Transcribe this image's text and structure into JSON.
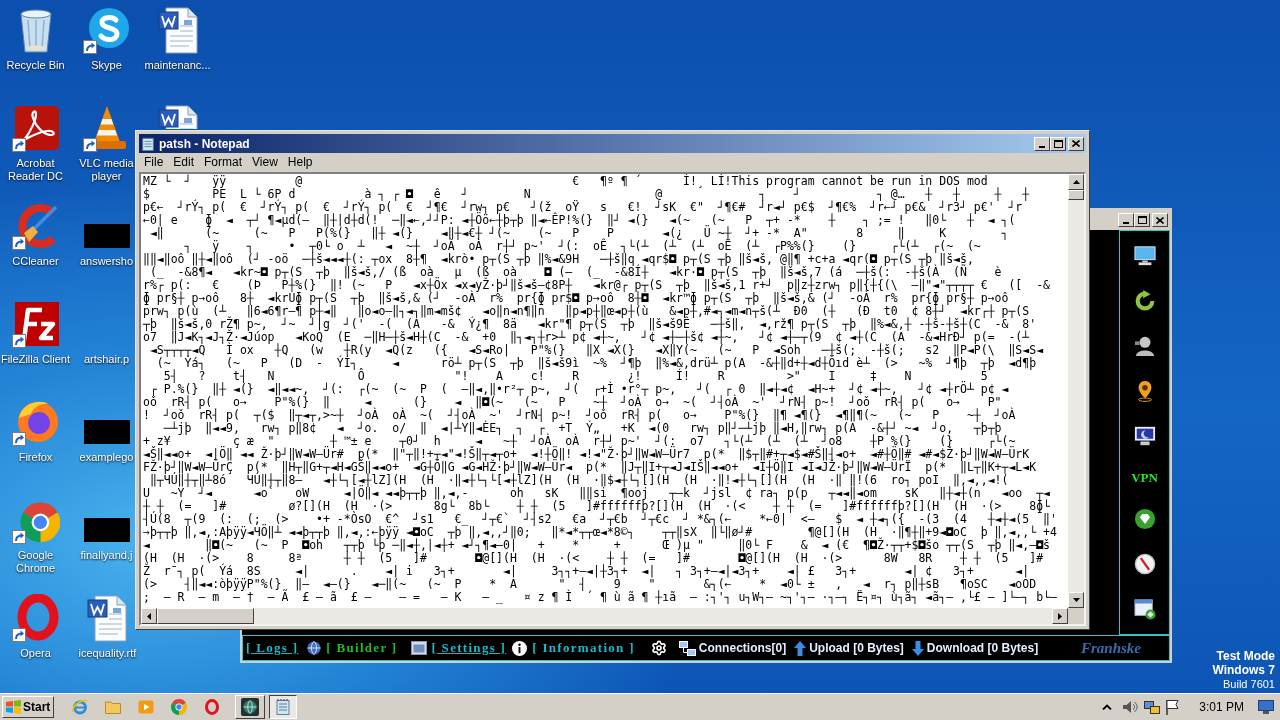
{
  "desktop": {
    "icons": [
      {
        "kind": "recycle",
        "label": "Recycle Bin",
        "shortcut": false
      },
      {
        "kind": "acrobat",
        "label": "Acrobat Reader DC",
        "shortcut": true
      },
      {
        "kind": "ccleaner",
        "label": "CCleaner",
        "shortcut": true
      },
      {
        "kind": "filezilla",
        "label": "FileZilla Client",
        "shortcut": true
      },
      {
        "kind": "firefox",
        "label": "Firefox",
        "shortcut": true
      },
      {
        "kind": "chrome",
        "label": "Google Chrome",
        "shortcut": true
      },
      {
        "kind": "opera",
        "label": "Opera",
        "shortcut": true
      },
      {
        "kind": "skype",
        "label": "Skype",
        "shortcut": true
      },
      {
        "kind": "vlc",
        "label": "VLC media player",
        "shortcut": true
      },
      {
        "kind": "thumbnail",
        "label": "answersho"
      },
      {
        "kind": "blank",
        "label": "artshair.p"
      },
      {
        "kind": "thumbnail",
        "label": "examplego"
      },
      {
        "kind": "thumbnail",
        "label": "finallyand.j"
      },
      {
        "kind": "word",
        "label": "icequality.rtf",
        "shortcut": false
      },
      {
        "kind": "word",
        "label": "maintenanc...",
        "shortcut": false
      },
      {
        "kind": "word"
      }
    ],
    "notice": [
      "Test Mode",
      "Windows 7",
      "Build 7601"
    ]
  },
  "notepad": {
    "title": "patsh - Notepad",
    "menu": [
      "File",
      "Edit",
      "Format",
      "View",
      "Help"
    ],
    "lines": [
      "MZ └  ┘   ÿÿ          @                                       €   ¶º ¶ ´      Í!¸ LÍ!This program cannot be run in DOS mod",
      "$         PE  L └ 6P d          à ┐ ┌ ◘   ê   ┘        N                  @              ┐    ┘           ┐ @…   ┼   ┼     ┼   ┼",
      "p€←  ┘rÝ┐ p(  €  ┘rÝ┐ p(  €  ┘rÝ┐ p(  €  ┘¶€  ┘rw┐ p€   ┘(ž  oŸ   s   €!  ┘sK  €\"  ┘¶€#  ┘r◄┘ p€$  ┘¶€%  ┘r←┘ p€&  ┘r3┘ p€'  ┘r",
      "←0| e    ɸ  ◄  ┬┘ ¶◄µd(–  ‖┼|d┼d(!  ─‖◄←,┘┘P: ◄┼Öö←┼þ┬þ ‖◄←ÊP!%(}  ‖┘ ◄(}   ◄(~   (~   P  ┬+ -*    ┼    ┐ ;= !   ‖0└   ┼  ◄ ┐(",
      " ◄‖      (~     (~   P   P(%(}   ‖┼ ◄(}    ◄‖┼◄€┼ ┘(~    (~   P    P       ◄(¿   Ü ~┼  ┘+ -*  A\"       8     ‖     K        ┐",
      "      ┐   ÿ    ┐     •  ┬0└ o  ┴   ◄  ~┼  ┘oÀ  oÀ  r┼┘ p~'  ┘(:  oÊ  ┐└(┴  (┴  (┴  oË  (┴  ┌P%%(}    (}     ┌└(┴  ┌(~  (~",
      "‖‖◄‖oô ‖┼◄‖oô  (┘ -oö  ─┼š◄◄◄┼(: ┬ox  8┼¶  ◄krò• p┬(S ┬þ ‖%◄&9H   ─┼š‖q ◄qr$◘ p┬(S ┬þ ‖š◄š, @‖¶ +c+a ◄qr(◘ p┬(S ┬þ ‖š◄š,",
      " (_  -&8¶◄   ◄kr~◘ p┬(S  ┬þ  ‖š◄š,/ (ß  oà   µ  (ß  oà    ◘ (–  (_  -&8Í┼   ◄kr·◘ p┬(S  ┬þ  ‖š◄š,7 (á  ─┼š(:  -┼š(À  (Ñ    è",
      "r%┌ p(:   €    (Þ   P┼%(}  ‖! (~   P   ◄x┼Öx ◄x◄yŽ·þ┘‖š◄š–¢8P┼   ◄kr@┌ p┬(S  ┬þ  ‖š◄š,1 r+┘  p‖z┼zrw┐ p‖{┼{(\\  –‖\"◄\"┬┬┬┬ €   ([  -&",
      "ɸ pr§┼ p→oô   8┼  ◄krUɸ p┬(S  ┬þ  ‖š◄š,& (┘  -oÀ  r%  pr{ɸ pr$◘ p→oô  8┼◘  ◄kr™ɸ p┬(S  ┬þ  ‖š◄š,& (┘  -oÀ  r%  pr{ɸ pr§┼ p→oô",
      "prw┐ p(ù  (┴   ‖6◄6¶r–¶ p┼◄‖   ‖o◄o–‖┐◄┐‖m◄mš¢   ◄o‖n◄n¶‖n   ‖p◄p┼‖œ◄p┼(ù   &◄p┼,#◄┐◄m◄n┬š(┴  Ð0  (┼   (Ð  t0  ¢ 8┼┘  ◄kr┌┼ p┬(S",
      "┬þ  ‖š◄š,0 rŽ¶ p~,  ┘~  ┘|g  ┘('  -(  (A   -&  Ý¿¶  8ä   ◄kr\"¶ p┬(S  ┬þ  ‖š◄š9Ê   ─┼š‖,  ◄,rž¶ p┬(S  ┬þ  ‖%◄&,┼ -┼š-┼š┼(C  -&  8'",
      "o7  ‖J◄K┐◄J┐Ž·◄Júop   ◄KoQ  (E  ─‖H─┼š◄H┼(C  -&  +0  ‖┐◄┐┼r>┴ p¢ ◄┼~,   ┘¢ ◄┼─┼š¢ ◄┼~,   ┘¢ ◄┼─┬(9  ¢ ◄┼(C  (A  -&◄HrÐ┘ p(=  -(┴",
      " ◄S┬┬┬┬◄Q   Ì ox   ┼Q   (w   ┼R(y  ◄Q(z   ({   ◄S◄Ro|   P\"%(}   ‖X ◄X(}   ◄X‖Y(~   (~   P  ◄Soh   ─┼š(;  -┼š(;   s2  ‖P◄P(\\  ‖S◄S◄",
      "  (~  Ýá┐   (~   P   (D  -  ÝÍ┐     ◄      rö┴ p┬(S  ┬þ  ‖š◄š9ì  ~%  ┘¶þ  ‖%◄&,drü┴ p(A  -&┼‖d+┼◄d┼Öıd è┴  (>   ~%  ┘¶þ  ┬þ  ◄d¶þ",
      "   5┤   ?    t┤   N            Ô             \"!    A    c!    R       ¿!     Í!    R         >\"    I     ‡    N          5",
      " ┌ P.%(}  ‖┼ ◄(}  ◄‖◄◄~,  ┘(:  ┌(~  (~  P  (  –‖◄,‖•r²┬ p~,  ┘(  ┌+Ì •r°┬ p~,   ┘(  ┌ 0  ‖◄┼◄¢  ◄H~+  ┘¢ ◄┼~,   ┘¢ ◄┼rÖ┴ p¢ ◄",
      "oǒ  rR┤ p(   o→    P\"%(}  ‖     ◄      (}    ◄  ‖◘(~   (~   P    ~┼  ┘oÀ  o→  ~(  ┘┤oÀ  ~'  ┘rN┤ p~!  ┘oǒ  rR┤ p(   o→    P\"",
      "!  ┘oǒ  rR┤ p(  ┬($  ‖┬◄┬,>~┼  ┘oÀ  oÀ  ~(  ┘┤oÀ  ~'  ┘rN┤ p~!  ┘oǒ  rR┤ p(   o→    P\"%(}  ‖¶ ◄¶(}  ◄¶‖¶(~   (~   P    ~┼  ┘oÀ",
      "   ─┴jþ  ‖◄◄9,   rw┐ p‖8¢   ◄  ┘o.  o/  ‖  ◄|┴Y‖◄ÈE┐  ┐  ┌  +T  Ý„   +K  ◄(0   rw┐ p‖┘─┴jþ ‖◄H,‖rw┐ p(A  -&┼┘ ~◄  ┘o,   ┬þ┬þ",
      "+ z¥         ç æ  \"        ┼ ™± e    ┬0┘  h     ◄   ~┼  ┘oÀ  oÀ  r┼┘ p~'  ┘(:  o7   ┐└(┴  (┴  (┴  ┘o8    ┼P %(}    (}     ┌└(~",
      "◄Š‖◄◄o+  ◄|Ö‖ ◄◄ Ž·þ┘‖W◄W–Ür#  p(*  ‖\"┬‖!+┬◄\"◄!Š‖┬◄┬o+  ◄!┼Ö‖! ◄!◄\"Ž·þ┘‖W◄W–Ür7  p(*  ‖$┬‖#+┬◄$◄#Š‖┤◄o+  ◄#┼Ö‖# ◄#◄$Ž·þ┘‖W◄W–ÜrK",
      "FŽ·þ┘‖W◄W–ÜrÇ  p(*  ‖H┬‖G+┬◄H◄GŠ‖◄◄o+  ◄G┼Ö‖G ◄G◄HŽ·þ┘‖W◄W–Ür◄  p(*  ‖J┬‖I+┬◄J◄IŠ‖◄◄o+  ◄I┼Ö‖I ◄I◄JŽ·þ┘‖W◄W–ÜrÏ  p(*  ‖L┬‖K+┬◄L◄K",
      " ‖┬ЧÚ‖┼┬‖┴8ó   ЧÚ‖┼┬‖8–   ◄┼└┐[◄┼lZ](H  (H  ·‖◄┼└┐└[◄┼lZ](H  (H  ·‖$◄┼└┐[](H  (H  ·‖!◄┼└┐[](H  (H  ·‖ ‖!(6  ro┐ poI  ‖,◄,,◄!(",
      "U   ~Y  ┘◄      ◄o`   oW     ◄|Ö‖◄ ◄◄þ┬┬þ ‖,◄,-      oh   sK   ‖‖si  ¶ooj   ┬–k  ┘jsl  ¢ ra┐ p(p   ┬◄◄‖◄om    sK   ‖┼◄┼(n   ◄oo  ┬◄",
      "┼ ┼  (=   ]#         ø?[](H  (H  ·(>      8g└  8b└    ┼ ┼  (5   ]#ffffffþ?[](H  (H  ·(<    ┼ ┼  (=   ]#ffffffþ?[](H  (H  ·(>    8ɸ└",
      "┤Ú(8  ┬(9  (:  (;  (>    •+ -*ÒsO  €^  ┘s1   €_  ┘┬€`  ┘┤s2   €a  ┘┬€b  ┘┬€c  ┘ *&┐(←    *←0|  <–   $  ◄ ┼◄┐({  -(3  (4   ┼◄┼◄(5  ‖'",
      "→þ┬┬þ ‖,◄,:Aþÿÿ◄ЧÖ‖┴ ◄◄þ┬┬þ ‖,◄,:←þÿÿ ◄◘oC  ┬þ ‖,◄,,┘‖0;   ‖*◄*┬┬œ◄*8©┐    ┬┬‖sX  ‖└‖ø┘#        ¶@[](H  (H  ·‖¶┼‖+9◄◘oC  þ ‖,◄,,└ +4",
      "◄        ‖◘(~   (~  P  ◘oh   ┬┬þ └þ ─‖◄┼,|◄┼+ ◄┘┐¶◄–0|   +    *     +      Œ )µ \"     ‖0└ F    &  ◄ (€  ¶◘Ž·┬┬+$◘šo ┬┬(S  ┬þ ‖◄,–◘š",
      "(H  (H  ·(>    8     8ª      ┼ ┼  (5   ]#       ◘@[](H  (H  ·(<    ┼ ┼  (=   ]#       ◘@[](H  (H  ·(>      8W   8R    ┼ ┼  (5   ]#",
      "Ž  r¯┐ p(  Ýá  8S     ◄|      .    ◄| i   3┐+       ◄|     3┐┐+–◄|┼3┐+  ◄|   ┐ 3┐+–◄|◄3┐+    ◄| £   3┐+       ◄| ¢   3┐+      ◄|",
      "(>    ┤‖◄◄:òþÿÿP\"%(}  ‖–  ◄–(}   ◄─‖(~   (~  P    *  A      \"  ┤    9    \"       &┐(←    *  ◄0└ ±   ,   ◄  r┐ p‖┼sB   ¶oSC   ◄oOD",
      ";  – R  – m  – †  – Ã  £ – ã  £ –    – =   – K   – _   ¤ z ¶ Ì  ´ ¶ ù ã ¶ ┼ıã  – :┐'┐ u┐W┐– ~┐'┐– ·┐–┐ Ë┐¤┐ ù┐ã┐ ◄ã┐– ,└£ – ]└–┐ b└–"
    ]
  },
  "dark_window": {
    "side_panel": [
      {
        "kind": "monitor"
      },
      {
        "kind": "refresh"
      },
      {
        "kind": "person"
      },
      {
        "kind": "pin"
      },
      {
        "kind": "screen"
      },
      {
        "kind": "text",
        "text": "VPN"
      },
      {
        "kind": "gem"
      },
      {
        "kind": "compass"
      },
      {
        "kind": "addwindow"
      }
    ],
    "toolbar": {
      "tabs": [
        {
          "text": "[ Logs ]",
          "color": "#1bb8c8",
          "underline": true
        },
        {
          "text": "[ Builder ]",
          "color": "#22bb22",
          "underline": false
        },
        {
          "text": "[ Settings ]",
          "color": "#1bb8c8",
          "underline": true
        },
        {
          "text": "[ Information ]",
          "color": "#1bb8c8",
          "underline": false
        }
      ],
      "stats": [
        {
          "kind": "connections",
          "text": "Connections[0]"
        },
        {
          "kind": "upload",
          "text": "Upload [0 Bytes]"
        },
        {
          "kind": "download",
          "text": "Download [0 Bytes]"
        }
      ],
      "brand": "Franhske"
    }
  },
  "taskbar": {
    "start": "Start",
    "tasks": [
      {
        "kind": "globe",
        "selected": false
      },
      {
        "kind": "notepad",
        "selected": true
      }
    ],
    "clock": "3:01 PM"
  }
}
